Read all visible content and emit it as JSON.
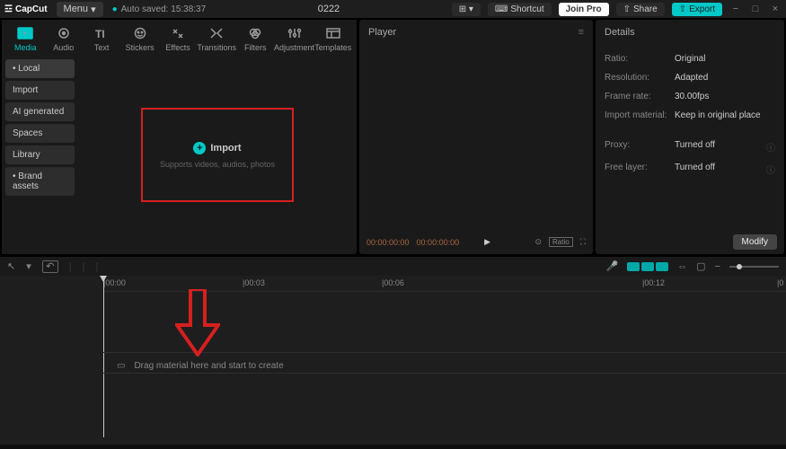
{
  "titlebar": {
    "app_name": "CapCut",
    "menu_label": "Menu",
    "autosave": "Auto saved: 15:38:37",
    "project": "0222",
    "shortcut": "Shortcut",
    "join": "Join Pro",
    "share": "Share",
    "export": "Export"
  },
  "tool_tabs": [
    {
      "label": "Media",
      "icon": "media"
    },
    {
      "label": "Audio",
      "icon": "audio"
    },
    {
      "label": "Text",
      "icon": "text"
    },
    {
      "label": "Stickers",
      "icon": "stickers"
    },
    {
      "label": "Effects",
      "icon": "effects"
    },
    {
      "label": "Transitions",
      "icon": "transitions"
    },
    {
      "label": "Filters",
      "icon": "filters"
    },
    {
      "label": "Adjustment",
      "icon": "adjustment"
    },
    {
      "label": "Templates",
      "icon": "templates"
    }
  ],
  "side_nav": [
    {
      "label": "Local",
      "star": true,
      "active": true
    },
    {
      "label": "Import"
    },
    {
      "label": "AI generated"
    },
    {
      "label": "Spaces"
    },
    {
      "label": "Library"
    },
    {
      "label": "Brand assets",
      "star": true
    }
  ],
  "import_box": {
    "label": "Import",
    "subtitle": "Supports videos, audios, photos"
  },
  "player": {
    "title": "Player",
    "time_current": "00:00:00:00",
    "time_total": "00:00:00:00",
    "ratio": "Ratio"
  },
  "details": {
    "title": "Details",
    "rows": [
      {
        "label": "Ratio:",
        "value": "Original"
      },
      {
        "label": "Resolution:",
        "value": "Adapted"
      },
      {
        "label": "Frame rate:",
        "value": "30.00fps"
      },
      {
        "label": "Import material:",
        "value": "Keep in original place"
      }
    ],
    "rows2": [
      {
        "label": "Proxy:",
        "value": "Turned off",
        "info": true
      },
      {
        "label": "Free layer:",
        "value": "Turned off",
        "info": true
      }
    ],
    "modify": "Modify"
  },
  "timeline": {
    "ticks": [
      "|00:00",
      "|00:03",
      "|00:06",
      "|00:12",
      "|0"
    ],
    "hint": "Drag material here and start to create"
  }
}
